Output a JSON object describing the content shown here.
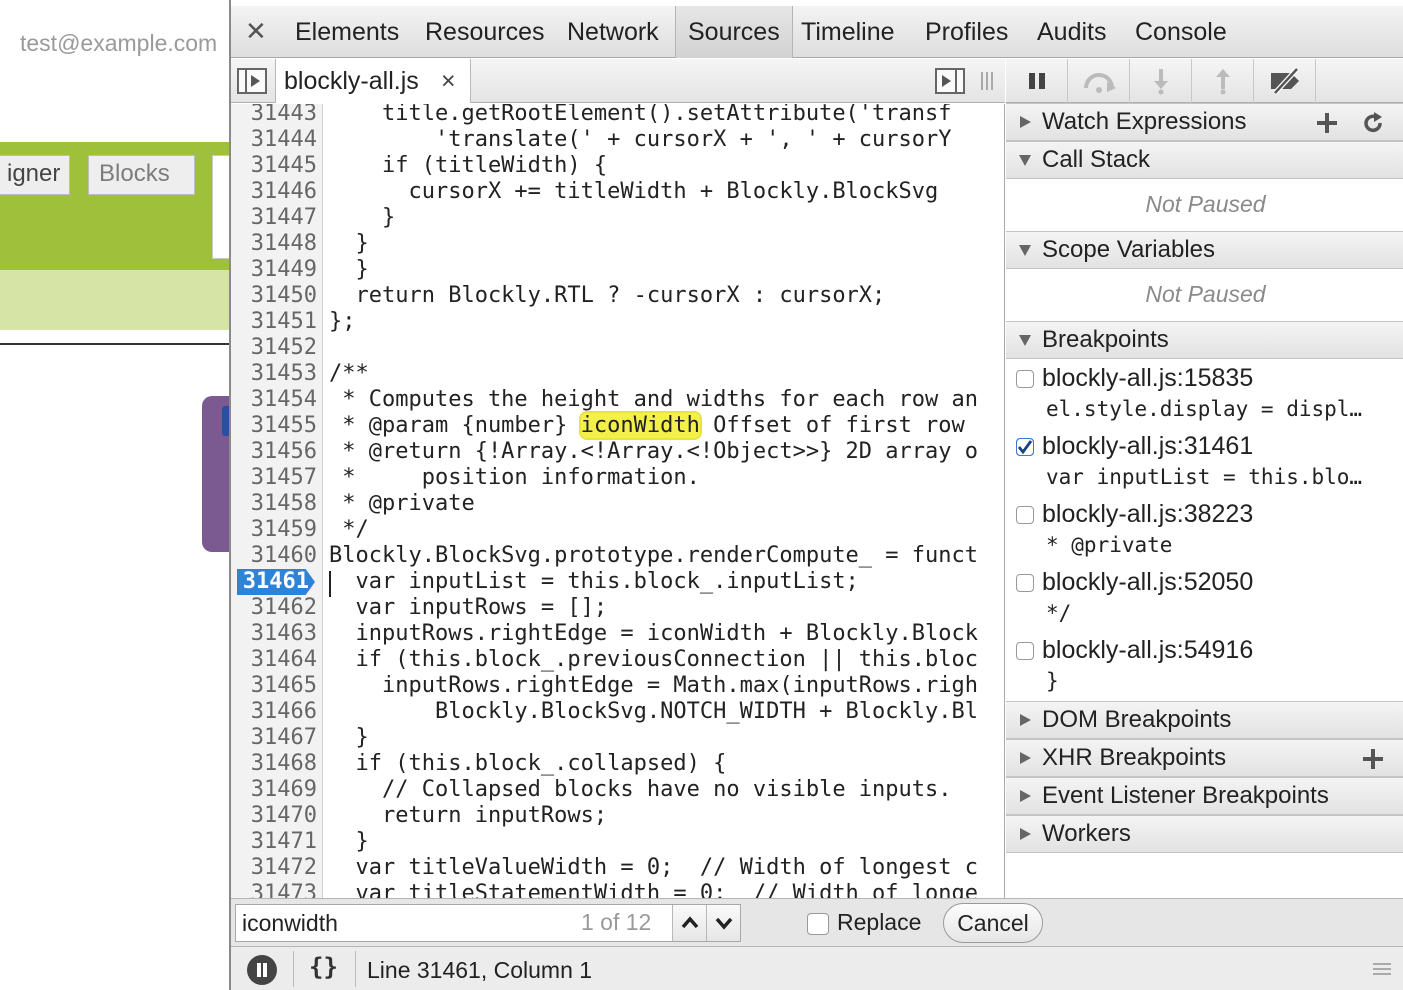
{
  "page": {
    "email": "test@example.com",
    "designer_label": "igner",
    "blocks_label": "Blocks"
  },
  "devtools": {
    "close_glyph": "✕",
    "tabs": [
      {
        "label": "Elements"
      },
      {
        "label": "Resources"
      },
      {
        "label": "Network"
      },
      {
        "label": "Sources",
        "active": true
      },
      {
        "label": "Timeline"
      },
      {
        "label": "Profiles"
      },
      {
        "label": "Audits"
      },
      {
        "label": "Console"
      }
    ],
    "file_tab": {
      "name": "blockly-all.js",
      "close_glyph": "×"
    },
    "code_lines": [
      {
        "num": "31443",
        "text": "    title.getRootElement().setAttribute('transf"
      },
      {
        "num": "31444",
        "text": "        'translate(' + cursorX + ', ' + cursorY"
      },
      {
        "num": "31445",
        "text": "    if (titleWidth) {"
      },
      {
        "num": "31446",
        "text": "      cursorX += titleWidth + Blockly.BlockSvg"
      },
      {
        "num": "31447",
        "text": "    }"
      },
      {
        "num": "31448",
        "text": "  }"
      },
      {
        "num": "31449",
        "text": "  }"
      },
      {
        "num": "31450",
        "text": "  return Blockly.RTL ? -cursorX : cursorX;"
      },
      {
        "num": "31451",
        "text": "};"
      },
      {
        "num": "31452",
        "text": ""
      },
      {
        "num": "31453",
        "text": "/**"
      },
      {
        "num": "31454",
        "text": " * Computes the height and widths for each row an"
      },
      {
        "num": "31455",
        "text_before": " * @param {number} ",
        "highlight": "iconWidth",
        "text_after": " Offset of first row"
      },
      {
        "num": "31456",
        "text": " * @return {!Array.<!Array.<!Object>>} 2D array o"
      },
      {
        "num": "31457",
        "text": " *     position information."
      },
      {
        "num": "31458",
        "text": " * @private"
      },
      {
        "num": "31459",
        "text": " */"
      },
      {
        "num": "31460",
        "text": "Blockly.BlockSvg.prototype.renderCompute_ = funct"
      },
      {
        "num": "31461",
        "text": "  var inputList = this.block_.inputList;",
        "breakpoint": true
      },
      {
        "num": "31462",
        "text": "  var inputRows = [];"
      },
      {
        "num": "31463",
        "text": "  inputRows.rightEdge = iconWidth + Blockly.Block"
      },
      {
        "num": "31464",
        "text": "  if (this.block_.previousConnection || this.bloc"
      },
      {
        "num": "31465",
        "text": "    inputRows.rightEdge = Math.max(inputRows.righ"
      },
      {
        "num": "31466",
        "text": "        Blockly.BlockSvg.NOTCH_WIDTH + Blockly.Bl"
      },
      {
        "num": "31467",
        "text": "  }"
      },
      {
        "num": "31468",
        "text": "  if (this.block_.collapsed) {"
      },
      {
        "num": "31469",
        "text": "    // Collapsed blocks have no visible inputs."
      },
      {
        "num": "31470",
        "text": "    return inputRows;"
      },
      {
        "num": "31471",
        "text": "  }"
      },
      {
        "num": "31472",
        "text": "  var titleValueWidth = 0;  // Width of longest c"
      },
      {
        "num": "31473",
        "text": "  var titleStatementWidth = 0;  // Width of longe"
      }
    ],
    "search": {
      "value": "iconwidth",
      "count": "1 of 12",
      "replace_label": "Replace",
      "cancel_label": "Cancel"
    },
    "status": {
      "pretty_print": "{}",
      "cursor": "Line 31461, Column 1"
    },
    "sidebar": {
      "watch_expressions": "Watch Expressions",
      "call_stack": "Call Stack",
      "call_stack_empty": "Not Paused",
      "scope_variables": "Scope Variables",
      "scope_empty": "Not Paused",
      "breakpoints": "Breakpoints",
      "breakpoint_items": [
        {
          "title": "blockly-all.js:15835",
          "snippet": "el.style.display = displ…",
          "checked": false
        },
        {
          "title": "blockly-all.js:31461",
          "snippet": "var inputList = this.blo…",
          "checked": true
        },
        {
          "title": "blockly-all.js:38223",
          "snippet": "* @private",
          "checked": false
        },
        {
          "title": "blockly-all.js:52050",
          "snippet": "*/",
          "checked": false
        },
        {
          "title": "blockly-all.js:54916",
          "snippet": "}",
          "checked": false
        }
      ],
      "dom_breakpoints": "DOM Breakpoints",
      "xhr_breakpoints": "XHR Breakpoints",
      "event_listener_breakpoints": "Event Listener Breakpoints",
      "workers": "Workers"
    }
  },
  "colors": {
    "breakpoint_blue": "#2f83d6",
    "search_highlight": "#f4f04a",
    "app_green": "#9fc03b",
    "app_purple": "#7b5a92"
  }
}
